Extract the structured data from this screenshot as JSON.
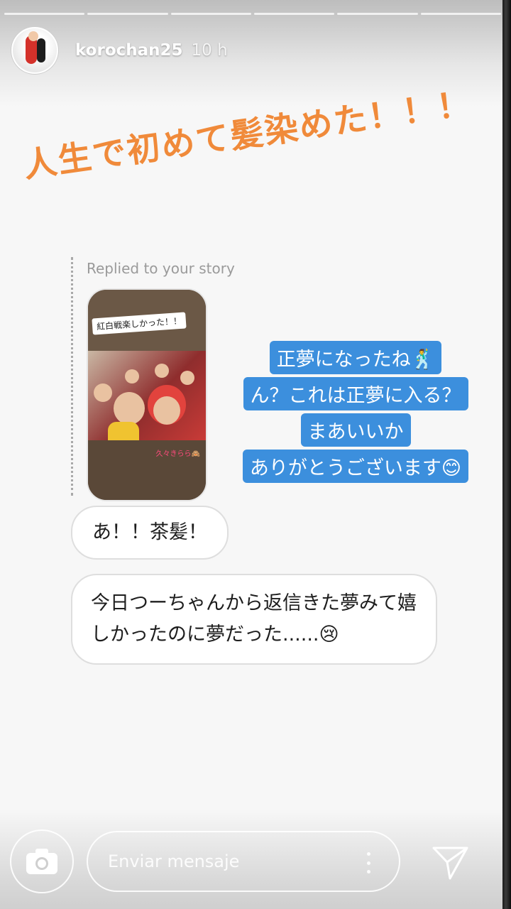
{
  "story": {
    "username": "korochan25",
    "time": "10 h",
    "segment_count": 6
  },
  "headline": "人生で初めて髪染めた！！！",
  "reply": {
    "label": "Replied to your story",
    "thumbnail": {
      "caption": "紅白戦楽しかった！！",
      "tag": "久々きらら🙈"
    },
    "lines": [
      "正夢になったね🕺",
      "ん？これは正夢に入る？",
      "まあいいか",
      "ありがとうございます😊"
    ]
  },
  "messages": [
    "あ！！茶髪！",
    "今日つーちゃんから返信きた夢みて嬉しかったのに夢だった......😢"
  ],
  "composer": {
    "placeholder": "Enviar mensaje"
  },
  "icons": {
    "camera": "camera-icon",
    "more": "more-vertical-icon",
    "send": "send-icon"
  },
  "colors": {
    "headline": "#f08a3a",
    "reply_bubble": "#3c8fdd"
  }
}
